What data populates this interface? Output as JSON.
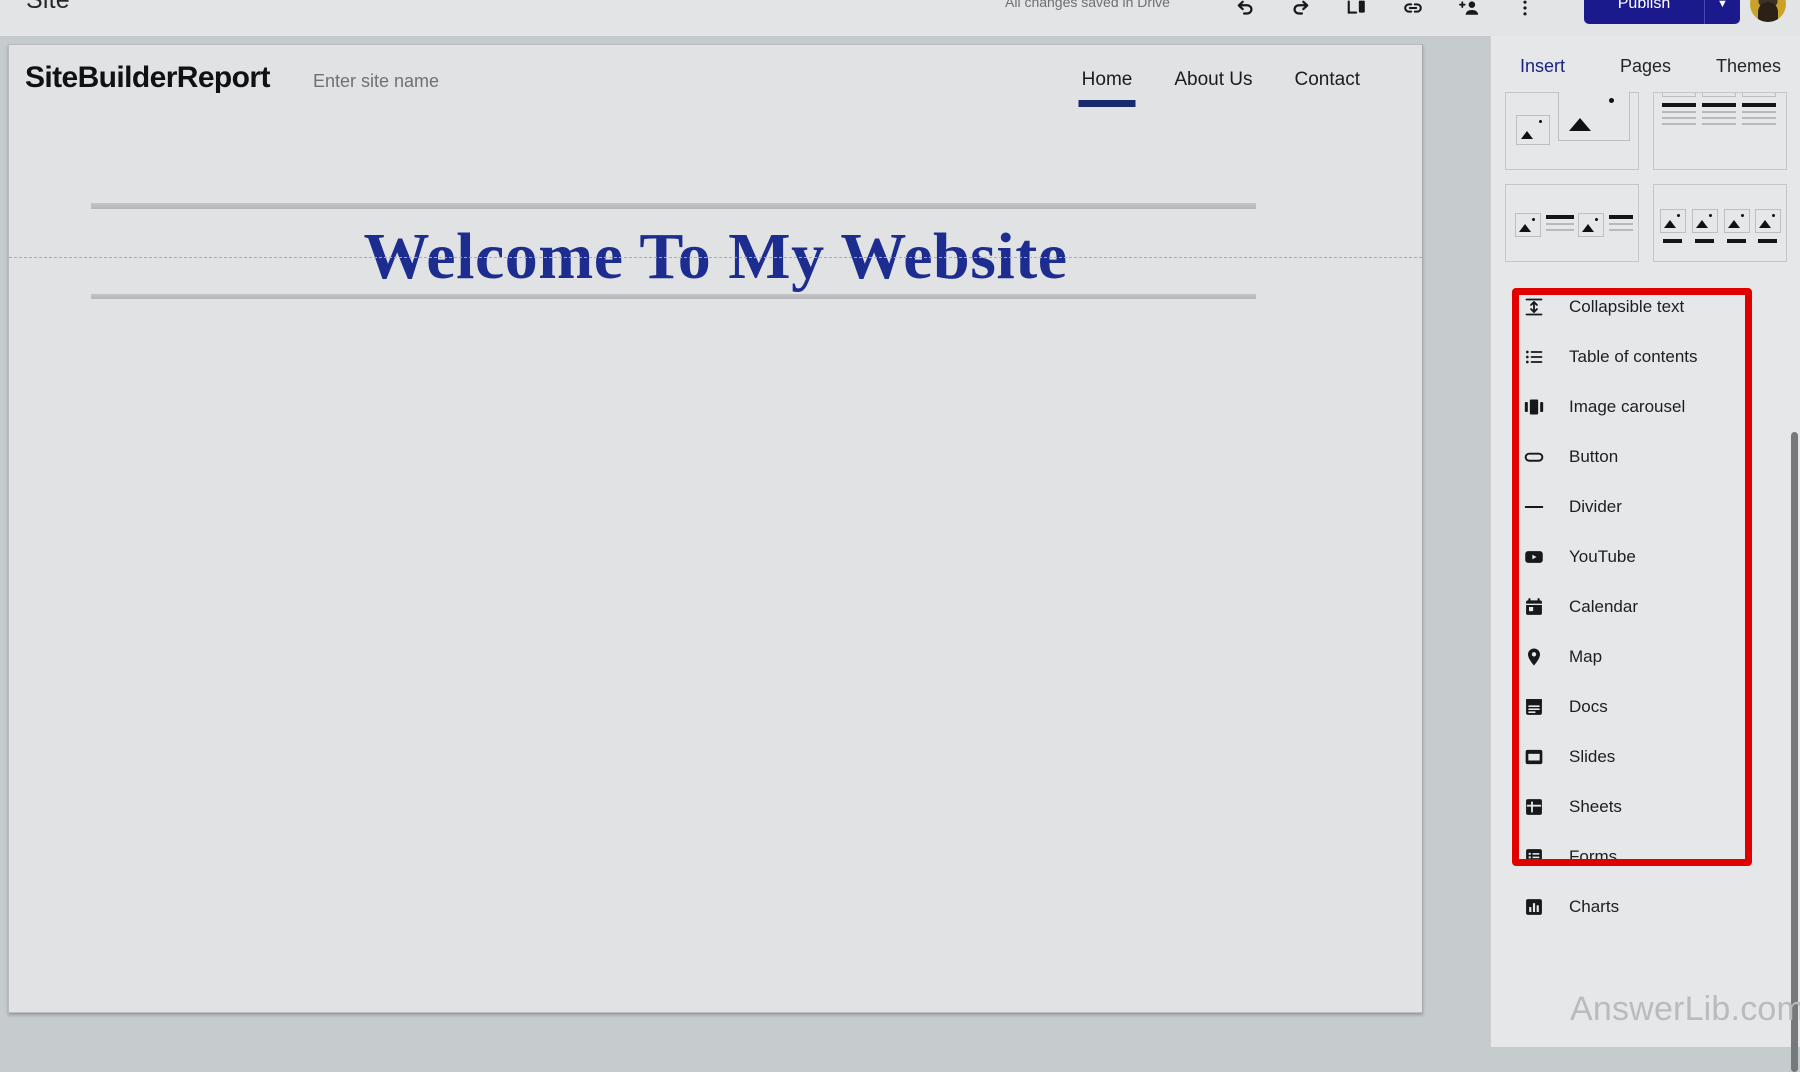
{
  "topbar": {
    "app_title": "Site",
    "save_status": "All changes saved in Drive",
    "icons": [
      {
        "name": "undo-icon",
        "label": "Undo"
      },
      {
        "name": "redo-icon",
        "label": "Redo"
      },
      {
        "name": "preview-icon",
        "label": "Preview"
      },
      {
        "name": "link-icon",
        "label": "Copy site link"
      },
      {
        "name": "share-icon",
        "label": "Share with others"
      },
      {
        "name": "more-options-icon",
        "label": "More"
      }
    ],
    "publish_label": "Publish",
    "publish_color": "#1a1a8c",
    "publish_dropdown_glyph": "▼"
  },
  "canvas": {
    "site_logo": "SiteBuilderReport",
    "site_name_placeholder": "Enter site name",
    "nav": [
      {
        "label": "Home",
        "active": true
      },
      {
        "label": "About Us",
        "active": false
      },
      {
        "label": "Contact",
        "active": false
      }
    ],
    "nav_active_color": "#172a6e",
    "hero_title": "Welcome To My Website",
    "hero_title_color": "#1d2d8f"
  },
  "panel": {
    "tabs": [
      {
        "label": "Insert",
        "active": true
      },
      {
        "label": "Pages",
        "active": false
      },
      {
        "label": "Themes",
        "active": false
      }
    ],
    "active_tab_color": "#1a237e",
    "layouts": [
      {
        "name": "layout-image-left-large-right"
      },
      {
        "name": "layout-three-column-text"
      },
      {
        "name": "layout-two-image-text-pairs"
      },
      {
        "name": "layout-four-image-captions"
      }
    ],
    "insert_items": [
      {
        "label": "Collapsible text",
        "icon": "collapsible-text-icon"
      },
      {
        "label": "Table of contents",
        "icon": "table-of-contents-icon"
      },
      {
        "label": "Image carousel",
        "icon": "image-carousel-icon"
      },
      {
        "label": "Button",
        "icon": "button-icon"
      },
      {
        "label": "Divider",
        "icon": "divider-icon"
      },
      {
        "label": "YouTube",
        "icon": "youtube-icon"
      },
      {
        "label": "Calendar",
        "icon": "calendar-icon"
      },
      {
        "label": "Map",
        "icon": "map-pin-icon"
      },
      {
        "label": "Docs",
        "icon": "docs-icon"
      },
      {
        "label": "Slides",
        "icon": "slides-icon"
      },
      {
        "label": "Sheets",
        "icon": "sheets-icon"
      },
      {
        "label": "Forms",
        "icon": "forms-icon"
      },
      {
        "label": "Charts",
        "icon": "charts-icon"
      }
    ],
    "highlight_color": "#e00000"
  },
  "watermark": "AnswerLib.com"
}
